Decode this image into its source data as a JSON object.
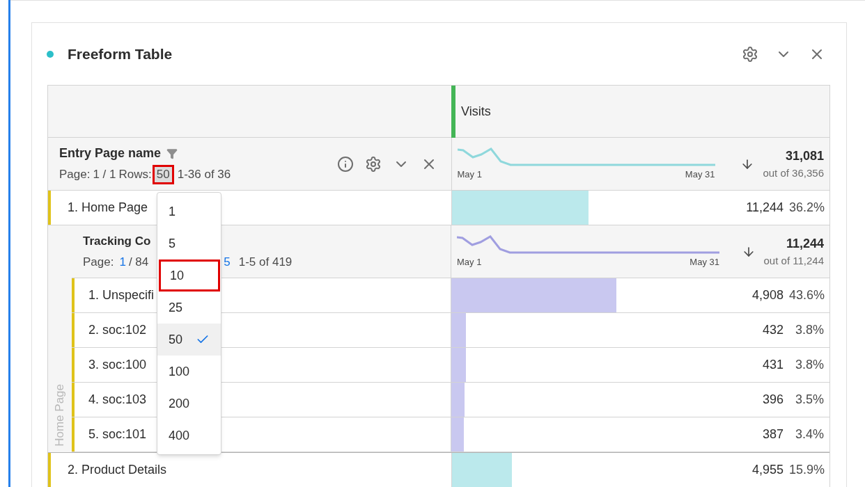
{
  "panel": {
    "title": "Freeform Table",
    "color": "#2cbfc9"
  },
  "metric_header": {
    "label": "Visits"
  },
  "dimension": {
    "name": "Entry Page name",
    "page_label": "Page:",
    "page": "1 / 1",
    "rows_label": "Rows:",
    "rows_value": "50",
    "rows_highlighted": true,
    "range": "1-36 of 36"
  },
  "total": {
    "value": "31,081",
    "out_of": "out of 36,356",
    "spark_start": "May 1",
    "spark_end": "May 31",
    "color": "#8fd8dc"
  },
  "rows": [
    {
      "rank": "1.",
      "name": "Home Page",
      "value": "11,244",
      "percent": "36.2%",
      "level": 0.362,
      "color": "#bbe9ec",
      "breakdown": {
        "parent_label": "Home Page",
        "name": "Tracking Co",
        "page_label": "Page:",
        "page": "1",
        "pages": "/ 84",
        "rows_fragment": "5",
        "range": "1-5 of 419",
        "total": {
          "value": "11,244",
          "out_of": "out of 11,244",
          "spark_start": "May 1",
          "spark_end": "May 31",
          "color": "#a09ee0"
        },
        "rows": [
          {
            "rank": "1.",
            "name": "Unspecifi",
            "value": "4,908",
            "percent": "43.6%",
            "level": 0.436,
            "color": "#c9c8f0"
          },
          {
            "rank": "2.",
            "name": "soc:102",
            "value": "432",
            "percent": "3.8%",
            "level": 0.038,
            "color": "#c9c8f0"
          },
          {
            "rank": "3.",
            "name": "soc:100",
            "value": "431",
            "percent": "3.8%",
            "level": 0.038,
            "color": "#c9c8f0"
          },
          {
            "rank": "4.",
            "name": "soc:103",
            "value": "396",
            "percent": "3.5%",
            "level": 0.035,
            "color": "#c9c8f0"
          },
          {
            "rank": "5.",
            "name": "soc:101",
            "value": "387",
            "percent": "3.4%",
            "level": 0.034,
            "color": "#c9c8f0"
          }
        ]
      }
    },
    {
      "rank": "2.",
      "name": "Product Details",
      "value": "4,955",
      "percent": "15.9%",
      "level": 0.159,
      "color": "#bbe9ec"
    }
  ],
  "rows_menu": {
    "options": [
      {
        "label": "1",
        "selected": false,
        "highlighted": false
      },
      {
        "label": "5",
        "selected": false,
        "highlighted": false
      },
      {
        "label": "10",
        "selected": false,
        "highlighted": true
      },
      {
        "label": "25",
        "selected": false,
        "highlighted": false
      },
      {
        "label": "50",
        "selected": true,
        "highlighted": false
      },
      {
        "label": "100",
        "selected": false,
        "highlighted": false
      },
      {
        "label": "200",
        "selected": false,
        "highlighted": false
      },
      {
        "label": "400",
        "selected": false,
        "highlighted": false
      }
    ]
  }
}
